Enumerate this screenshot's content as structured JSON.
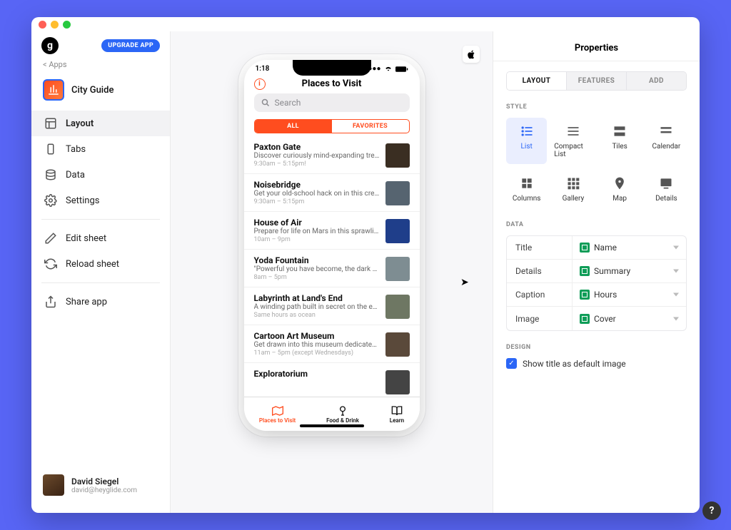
{
  "window": {
    "upgrade_label": "UPGRADE APP",
    "back_label": "< Apps",
    "app_name": "City Guide",
    "logo_letter": "g"
  },
  "sidebar": {
    "nav": [
      {
        "label": "Layout"
      },
      {
        "label": "Tabs"
      },
      {
        "label": "Data"
      },
      {
        "label": "Settings"
      }
    ],
    "actions": [
      {
        "label": "Edit sheet"
      },
      {
        "label": "Reload sheet"
      }
    ],
    "share_label": "Share app"
  },
  "user": {
    "name": "David Siegel",
    "email": "david@heyglide.com"
  },
  "phone": {
    "time": "1:18",
    "title": "Places to Visit",
    "search_placeholder": "Search",
    "segment": {
      "all": "ALL",
      "favorites": "FAVORITES"
    },
    "items": [
      {
        "title": "Paxton Gate",
        "detail": "Discover curiously mind-expanding trea...",
        "caption": "9:30am – 5:15pm!",
        "thumb": "#3a2e22"
      },
      {
        "title": "Noisebridge",
        "detail": "Get your old-school hack on in this crea...",
        "caption": "9:30am – 5:15pm",
        "thumb": "#566470"
      },
      {
        "title": "House of Air",
        "detail": "Prepare for life on Mars in this sprawling...",
        "caption": "10am – 9pm",
        "thumb": "#1f3e8a"
      },
      {
        "title": "Yoda Fountain",
        "detail": "\"Powerful you have become, the dark si...",
        "caption": "8am – 5pm",
        "thumb": "#7e8d92"
      },
      {
        "title": "Labyrinth at Land's End",
        "detail": "A winding path built in secret on the ed...",
        "caption": "Same hours as ocean",
        "thumb": "#6e7763"
      },
      {
        "title": "Cartoon Art Museum",
        "detail": "Get drawn into this museum dedicated t...",
        "caption": "11am – 5pm (except Wednesdays)",
        "thumb": "#5a493a"
      },
      {
        "title": "Exploratorium",
        "detail": "",
        "caption": "",
        "thumb": "#444"
      }
    ],
    "tabs": [
      {
        "label": "Places to Visit"
      },
      {
        "label": "Food & Drink"
      },
      {
        "label": "Learn"
      }
    ]
  },
  "panel": {
    "title": "Properties",
    "tabs": {
      "layout": "LAYOUT",
      "features": "FEATURES",
      "add": "ADD"
    },
    "sections": {
      "style": "STYLE",
      "data": "DATA",
      "design": "DESIGN"
    },
    "styles": [
      {
        "label": "List"
      },
      {
        "label": "Compact List"
      },
      {
        "label": "Tiles"
      },
      {
        "label": "Calendar"
      },
      {
        "label": "Columns"
      },
      {
        "label": "Gallery"
      },
      {
        "label": "Map"
      },
      {
        "label": "Details"
      }
    ],
    "data_rows": [
      {
        "key": "Title",
        "value": "Name"
      },
      {
        "key": "Details",
        "value": "Summary"
      },
      {
        "key": "Caption",
        "value": "Hours"
      },
      {
        "key": "Image",
        "value": "Cover"
      }
    ],
    "design_checkbox": "Show title as default image"
  }
}
